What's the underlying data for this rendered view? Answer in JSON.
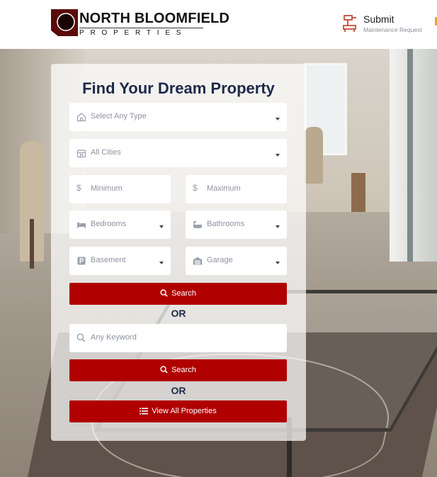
{
  "header": {
    "logo_name": "NORTH BLOOMFIELD",
    "logo_sub": "PROPERTIES",
    "submit_title": "Submit",
    "submit_sub": "Maintenance Request"
  },
  "search": {
    "title": "Find Your Dream Property",
    "type_placeholder": "Select Any Type",
    "city_placeholder": "All Cities",
    "min_placeholder": "Minimum",
    "max_placeholder": "Maximum",
    "bedrooms_placeholder": "Bedrooms",
    "bathrooms_placeholder": "Bathrooms",
    "basement_placeholder": "Basement",
    "garage_placeholder": "Garage",
    "search_label": "Search",
    "or_label": "OR",
    "keyword_placeholder": "Any Keyword",
    "search2_label": "Search",
    "or2_label": "OR",
    "view_all_label": "View All Properties"
  },
  "icons": {
    "type": "home-icon",
    "city": "building-icon",
    "min": "dollar-icon",
    "max": "dollar-icon",
    "bedrooms": "bed-icon",
    "bathrooms": "bathtub-icon",
    "basement": "parking-icon",
    "garage": "garage-icon",
    "search": "search-icon",
    "keyword": "search-icon",
    "list": "list-icon",
    "maintenance": "maintenance-icon"
  },
  "colors": {
    "brand_red": "#b00000",
    "title_navy": "#1f2a4a",
    "logo_dark_red": "#5a0a0a",
    "accent_orange": "#e6a23c"
  }
}
